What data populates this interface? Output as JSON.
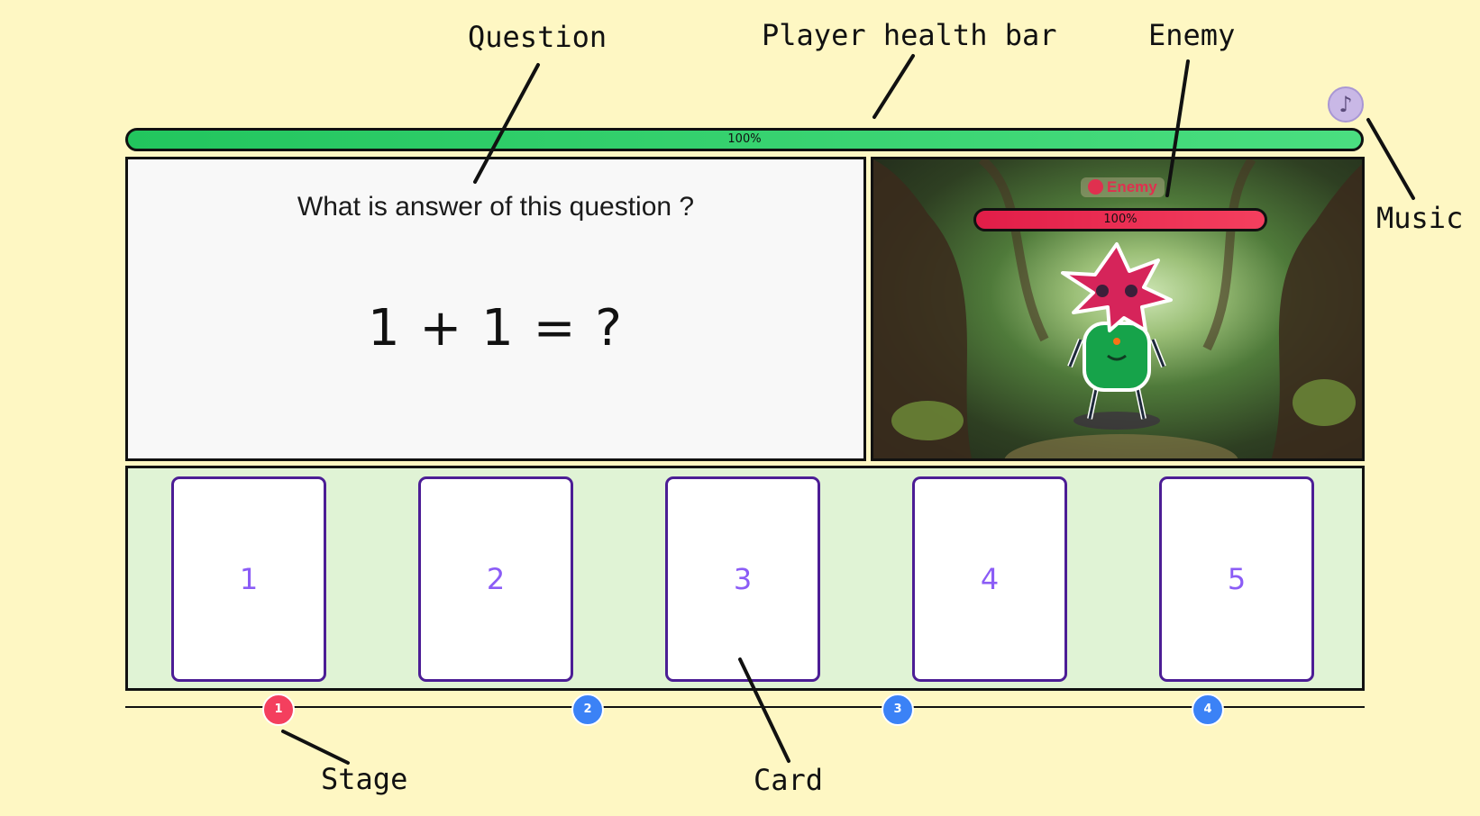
{
  "annotations": {
    "question": "Question",
    "player_health_bar": "Player health bar",
    "enemy": "Enemy",
    "music": "Music",
    "stage": "Stage",
    "card": "Card"
  },
  "music_button": {
    "icon": "music-note-icon",
    "glyph": "♪"
  },
  "player": {
    "health_fraction": 1.0,
    "health_text": "100%",
    "color": "#22c55e"
  },
  "question": {
    "prompt": "What is answer of this question ?",
    "expression": "1 + 1 = ?"
  },
  "enemy": {
    "name": "Enemy",
    "icon": "devil-face-icon",
    "health_fraction": 1.0,
    "health_text": "100%",
    "color": "#e11d48"
  },
  "cards": [
    {
      "label": "1"
    },
    {
      "label": "2"
    },
    {
      "label": "3"
    },
    {
      "label": "4"
    },
    {
      "label": "5"
    }
  ],
  "stages": [
    {
      "label": "1",
      "state": "current",
      "color": "#f43f5e"
    },
    {
      "label": "2",
      "state": "upcoming",
      "color": "#3b82f6"
    },
    {
      "label": "3",
      "state": "upcoming",
      "color": "#3b82f6"
    },
    {
      "label": "4",
      "state": "upcoming",
      "color": "#3b82f6"
    }
  ]
}
